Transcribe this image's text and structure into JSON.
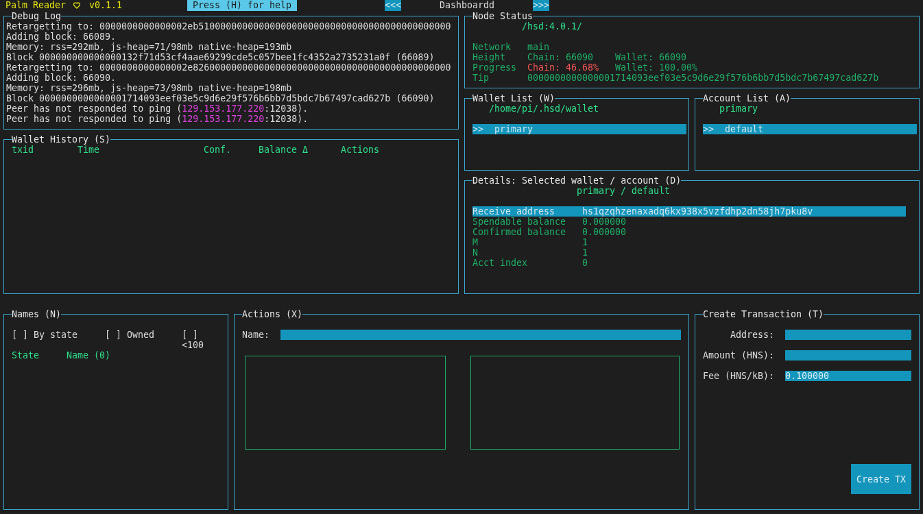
{
  "header": {
    "app_name": "Palm Reader",
    "version": "v0.1.1",
    "help_hint": "Press (H) for help",
    "nav_prev": "<<<",
    "page_title": "Dashboardd",
    "nav_next": ">>>"
  },
  "debug_log": {
    "title": "Debug Log",
    "lines": [
      {
        "kind": "plain",
        "text": "Retargetting to: 0000000000000002eb5100000000000000000000000000000000000000000000"
      },
      {
        "kind": "plain",
        "text": "Adding block: 66089."
      },
      {
        "kind": "plain",
        "text": "Memory: rss=292mb, js-heap=71/98mb native-heap=193mb"
      },
      {
        "kind": "plain",
        "text": "Block 000000000000000132f71d53cf4aae69299cde5c057bee1fc4352a2735231a0f (66089)"
      },
      {
        "kind": "plain",
        "text": "Retargetting to: 0000000000000002e82600000000000000000000000000000000000000000000"
      },
      {
        "kind": "plain",
        "text": "Adding block: 66090."
      },
      {
        "kind": "plain",
        "text": "Memory: rss=296mb, js-heap=73/98mb native-heap=198mb"
      },
      {
        "kind": "plain",
        "text": "Block 0000000000000001714093eef03e5c9d6e29f576b6bb7d5bdc7b67497cad627b (66090)"
      },
      {
        "kind": "peer",
        "prefix": "Peer has not responded to ping (",
        "address": "129.153.177.220",
        "suffix": ":12038)."
      },
      {
        "kind": "peer",
        "prefix": "Peer has not responded to ping (",
        "address": "129.153.177.220",
        "suffix": ":12038)."
      }
    ]
  },
  "node_status": {
    "title": "Node Status",
    "version": "/hsd:4.0.1/",
    "rows": [
      {
        "label": "Network",
        "values": [
          {
            "text": "main",
            "alert": false
          }
        ]
      },
      {
        "label": "Height",
        "values": [
          {
            "text": "Chain: 66090",
            "alert": false
          },
          {
            "text": "Wallet: 66090",
            "alert": false
          }
        ]
      },
      {
        "label": "Progress",
        "values": [
          {
            "text": "Chain: 46.68%",
            "alert": true
          },
          {
            "text": "Wallet: 100.00%",
            "alert": false
          }
        ]
      },
      {
        "label": "Tip",
        "values": [
          {
            "text": "0000000000000001714093eef03e5c9d6e29f576b6bb7d5bdc7b67497cad627b",
            "alert": false
          }
        ]
      }
    ]
  },
  "wallet_history": {
    "title": "Wallet History (S)",
    "columns": [
      "txid",
      "Time",
      "Conf.",
      "Balance Δ",
      "Actions"
    ]
  },
  "wallet_list": {
    "title": "Wallet List (W)",
    "heading": "/home/pi/.hsd/wallet",
    "items": [
      {
        "marker": ">>",
        "label": "primary",
        "selected": true
      }
    ]
  },
  "account_list": {
    "title": "Account List (A)",
    "heading": "primary",
    "items": [
      {
        "marker": ">>",
        "label": "default",
        "selected": true
      }
    ]
  },
  "details": {
    "title": "Details: Selected wallet / account (D)",
    "subtitle": "primary / default",
    "rows": [
      {
        "label": "Receive address",
        "value": "hs1qzqhzenaxadq6kx938x5vzfdhp2dn58jh7pku8v",
        "selected": true
      },
      {
        "label": "Spendable balance",
        "value": "0.000000",
        "selected": false
      },
      {
        "label": "Confirmed balance",
        "value": "0.000000",
        "selected": false
      },
      {
        "label": "M",
        "value": "1",
        "selected": false
      },
      {
        "label": "N",
        "value": "1",
        "selected": false
      },
      {
        "label": "Acct index",
        "value": "0",
        "selected": false
      }
    ]
  },
  "names": {
    "title": "Names (N)",
    "filters": [
      {
        "box": "[ ]",
        "label": "By state",
        "checked": false
      },
      {
        "box": "[ ]",
        "label": "Owned",
        "checked": false
      },
      {
        "box": "[ ]",
        "label": "<100",
        "checked": false
      }
    ],
    "columns": [
      "State",
      "Name (0)"
    ]
  },
  "actions": {
    "title": "Actions (X)",
    "name_label": "Name:"
  },
  "create_transaction": {
    "title": "Create Transaction (T)",
    "fields": [
      {
        "label": "Address:"
      },
      {
        "label": "Amount (HNS):"
      },
      {
        "label": "Fee (HNS/kB):",
        "value": "0.100000"
      }
    ],
    "button": "Create TX"
  }
}
